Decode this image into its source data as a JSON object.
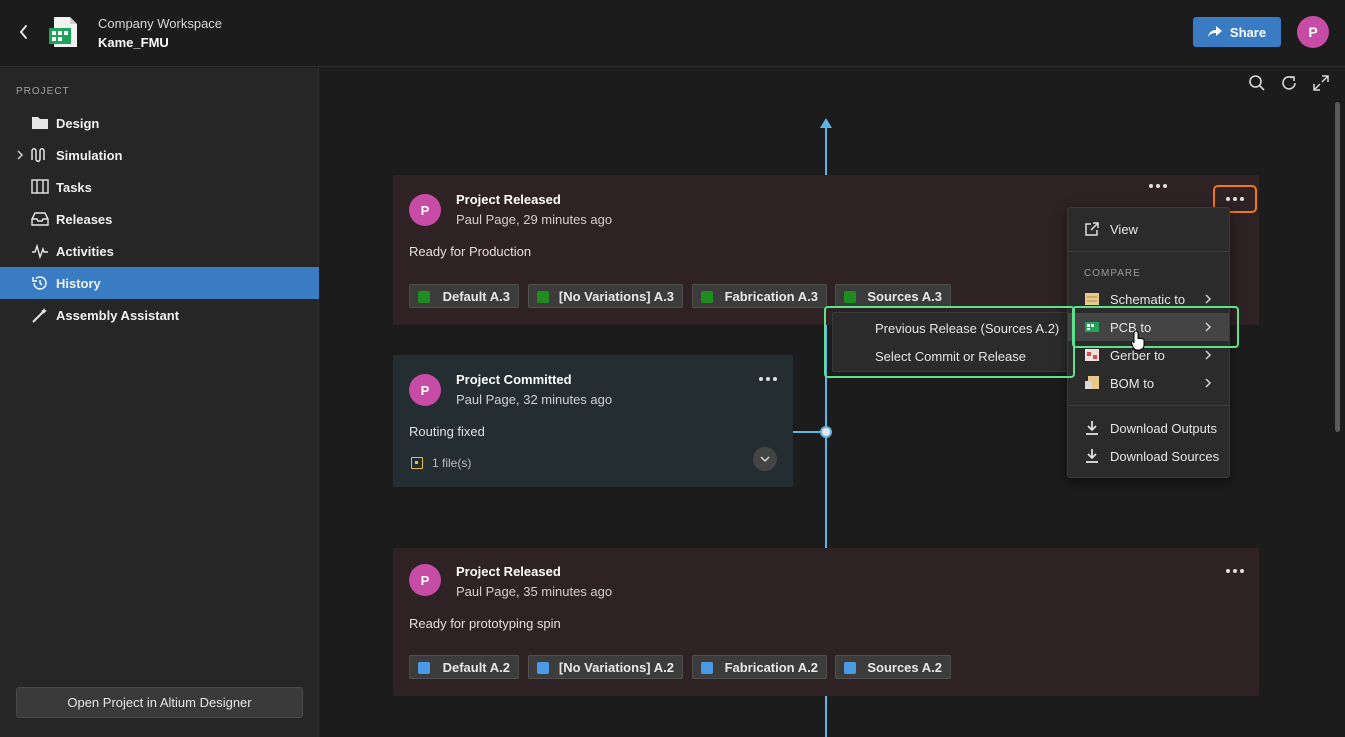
{
  "header": {
    "workspace": "Company Workspace",
    "project": "Kame_FMU",
    "share_label": "Share",
    "avatar_initial": "P"
  },
  "sidebar": {
    "section": "PROJECT",
    "items": [
      {
        "label": "Design",
        "icon": "folder-icon"
      },
      {
        "label": "Simulation",
        "icon": "waveform-icon"
      },
      {
        "label": "Tasks",
        "icon": "kanban-icon"
      },
      {
        "label": "Releases",
        "icon": "inbox-icon"
      },
      {
        "label": "Activities",
        "icon": "pulse-icon"
      },
      {
        "label": "History",
        "icon": "history-icon"
      },
      {
        "label": "Assembly Assistant",
        "icon": "wand-icon"
      }
    ],
    "open_button": "Open Project in Altium Designer"
  },
  "timeline": {
    "cards": [
      {
        "type": "released",
        "avatar": "P",
        "title": "Project Released",
        "subtitle": "Paul Page, 29 minutes ago",
        "description": "Ready for Production",
        "chips": [
          {
            "label": "Default A.3",
            "color": "#1e8c1e"
          },
          {
            "label": "[No Variations] A.3",
            "color": "#1e8c1e"
          },
          {
            "label": "Fabrication A.3",
            "color": "#1e8c1e"
          },
          {
            "label": "Sources A.3",
            "color": "#1e8c1e"
          }
        ]
      },
      {
        "type": "committed",
        "avatar": "P",
        "title": "Project Committed",
        "subtitle": "Paul Page, 32 minutes ago",
        "description": "Routing fixed",
        "files": "1 file(s)"
      },
      {
        "type": "released",
        "avatar": "P",
        "title": "Project Released",
        "subtitle": "Paul Page, 35 minutes ago",
        "description": "Ready for prototyping spin",
        "chips": [
          {
            "label": "Default A.2",
            "color": "#4a9ae6"
          },
          {
            "label": "[No Variations] A.2",
            "color": "#4a9ae6"
          },
          {
            "label": "Fabrication A.2",
            "color": "#4a9ae6"
          },
          {
            "label": "Sources A.2",
            "color": "#4a9ae6"
          }
        ]
      }
    ]
  },
  "context_menu": {
    "view": "View",
    "section": "COMPARE",
    "schematic": "Schematic to",
    "pcb": "PCB to",
    "gerber": "Gerber to",
    "bom": "BOM to",
    "download_outputs": "Download Outputs",
    "download_sources": "Download Sources"
  },
  "submenu": {
    "previous": "Previous Release (Sources A.2)",
    "select": "Select Commit or Release"
  },
  "colors": {
    "accent": "#3a7cc3",
    "avatar": "#c64ca6",
    "highlight_green": "#5fe08a",
    "highlight_orange": "#f07a1a",
    "timeline": "#5fb4e6"
  }
}
